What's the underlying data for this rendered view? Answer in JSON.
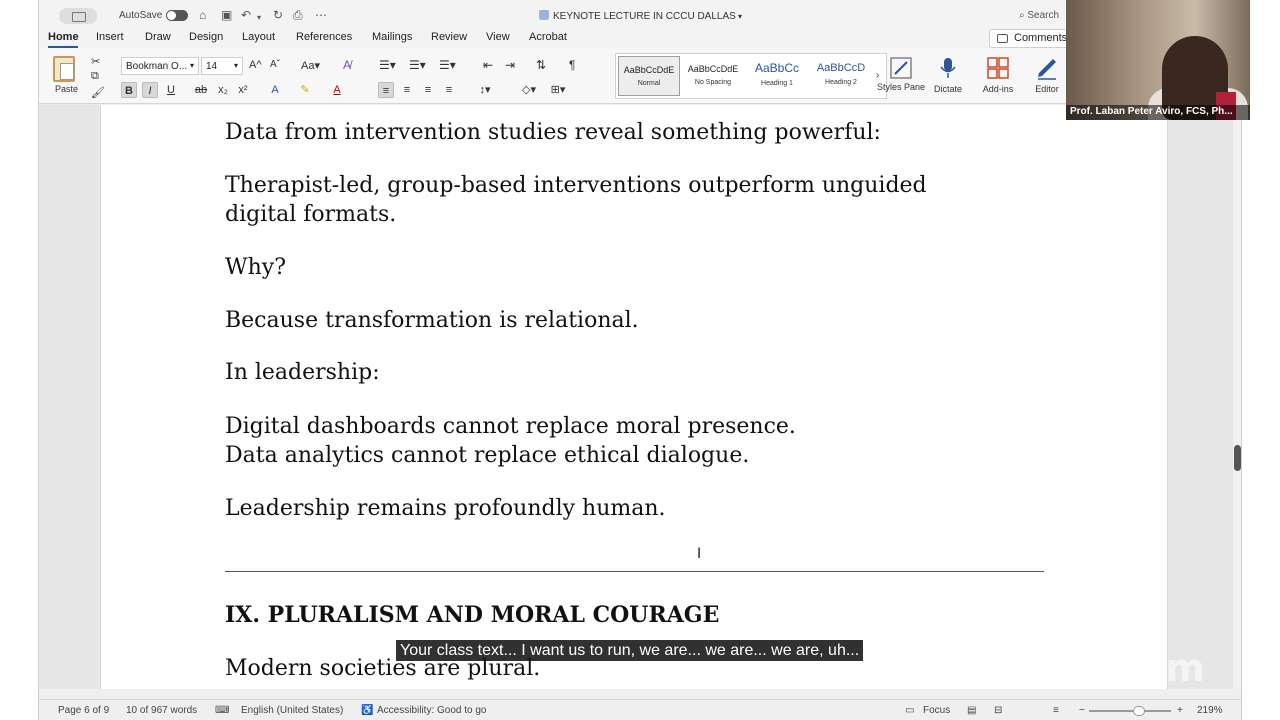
{
  "titlebar": {
    "autosave_label": "AutoSave",
    "document_title": "KEYNOTE LECTURE IN CCCU DALLAS",
    "search_label": "Search"
  },
  "ribbon_tabs": [
    "Home",
    "Insert",
    "Draw",
    "Design",
    "Layout",
    "References",
    "Mailings",
    "Review",
    "View",
    "Acrobat"
  ],
  "comments_label": "Comments",
  "ribbon": {
    "paste_label": "Paste",
    "font_name": "Bookman O...",
    "font_size": "14",
    "styles": [
      {
        "preview": "AaBbCcDdE",
        "name": "Normal"
      },
      {
        "preview": "AaBbCcDdE",
        "name": "No Spacing"
      },
      {
        "preview": "AaBbCc",
        "name": "Heading 1"
      },
      {
        "preview": "AaBbCcD",
        "name": "Heading 2"
      }
    ],
    "styles_pane_label": "Styles Pane",
    "dictate_label": "Dictate",
    "addins_label": "Add-ins",
    "editor_label": "Editor"
  },
  "document": {
    "p1": "Data from intervention studies reveal something powerful:",
    "p2a": "Therapist-led, group-based interventions outperform unguided",
    "p2b": "digital formats.",
    "p3": "Why?",
    "p4": "Because transformation is relational.",
    "p5": "In leadership:",
    "p6a": "Digital dashboards cannot replace moral presence.",
    "p6b": "Data analytics cannot replace ethical dialogue.",
    "p7": "Leadership remains profoundly human.",
    "heading": "IX. PLURALISM AND MORAL COURAGE",
    "p8": "Modern societies are plural."
  },
  "statusbar": {
    "page": "Page 6 of 9",
    "words": "10 of 967 words",
    "language": "English (United States)",
    "accessibility": "Accessibility: Good to go",
    "focus": "Focus",
    "zoom": "219%"
  },
  "overlay": {
    "caption": "Your class text... I want us to run, we are... we are... we are, uh...",
    "participant_name": "Prof. Laban Peter Aviro, FCS, Ph...",
    "watermark": "zoom"
  },
  "colors": {
    "accent": "#2b579a",
    "caption_bg": "#141414"
  }
}
